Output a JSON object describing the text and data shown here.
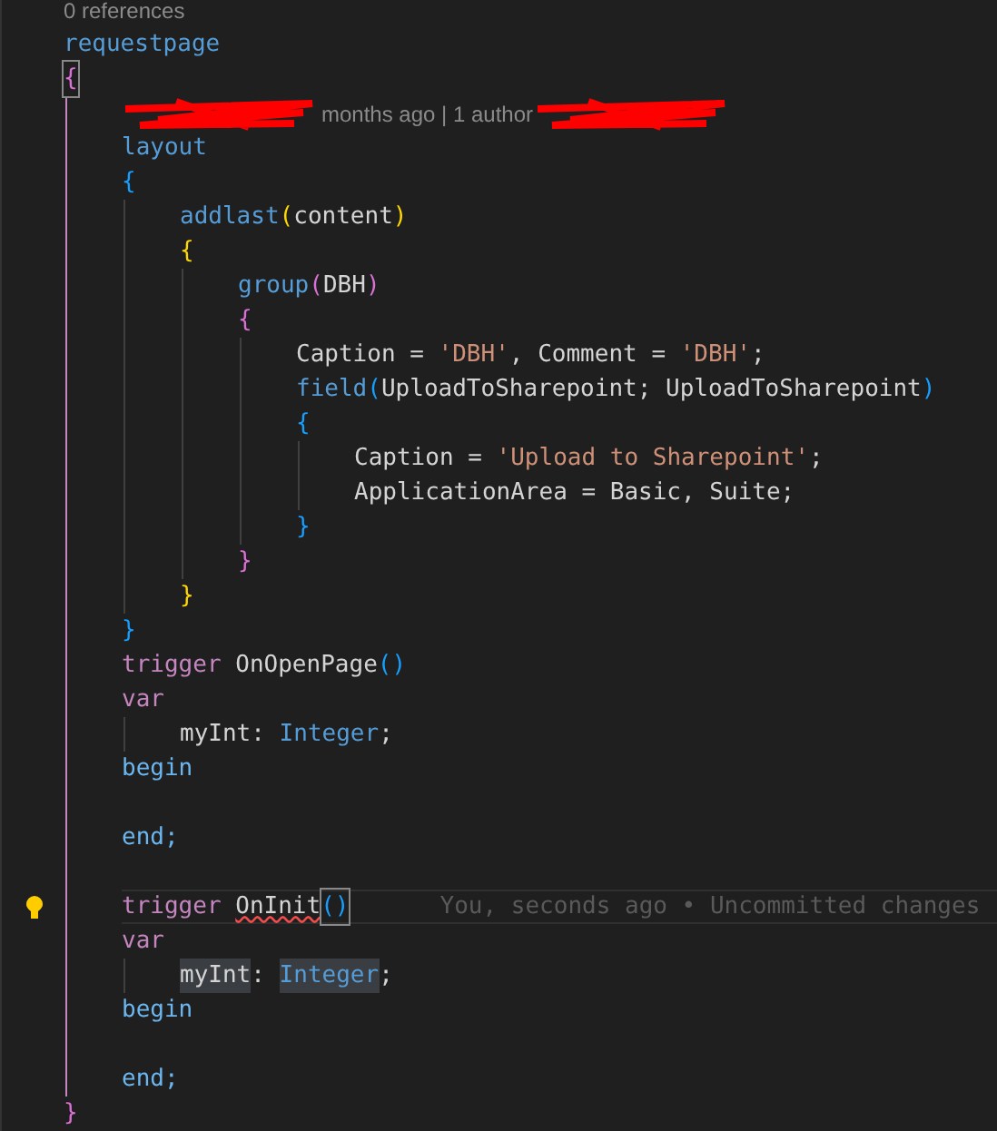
{
  "editor": {
    "lines": [
      {
        "kind": "codelens",
        "tokens": [
          {
            "t": "0 references",
            "kind": "text"
          }
        ]
      },
      {
        "kind": "code",
        "tokens": [
          {
            "t": "requestpage",
            "kind": "kw"
          }
        ]
      },
      {
        "kind": "code",
        "tokens": [
          {
            "t": "{",
            "kind": "b2",
            "matched": true
          }
        ],
        "children": [
          {
            "kind": "codelens",
            "tokens": [
              {
                "kind": "redacted"
              },
              {
                "t": "months ago | 1 author",
                "kind": "text"
              },
              {
                "kind": "redacted"
              }
            ]
          },
          {
            "kind": "code",
            "tokens": [
              {
                "t": "layout",
                "kind": "kw"
              }
            ]
          },
          {
            "kind": "code",
            "tokens": [
              {
                "t": "{",
                "kind": "b3"
              }
            ],
            "children": [
              {
                "kind": "code",
                "tokens": [
                  {
                    "t": "addlast",
                    "kind": "kw"
                  },
                  {
                    "t": "(",
                    "kind": "b1"
                  },
                  {
                    "t": "content",
                    "kind": "plain"
                  },
                  {
                    "t": ")",
                    "kind": "b1"
                  }
                ]
              },
              {
                "kind": "code",
                "tokens": [
                  {
                    "t": "{",
                    "kind": "b1"
                  }
                ],
                "children": [
                  {
                    "kind": "code",
                    "tokens": [
                      {
                        "t": "group",
                        "kind": "kw"
                      },
                      {
                        "t": "(",
                        "kind": "b2"
                      },
                      {
                        "t": "DBH",
                        "kind": "plain"
                      },
                      {
                        "t": ")",
                        "kind": "b2"
                      }
                    ]
                  },
                  {
                    "kind": "code",
                    "tokens": [
                      {
                        "t": "{",
                        "kind": "b2"
                      }
                    ],
                    "children": [
                      {
                        "kind": "code",
                        "tokens": [
                          {
                            "t": "Caption = ",
                            "kind": "plain"
                          },
                          {
                            "t": "'DBH'",
                            "kind": "str"
                          },
                          {
                            "t": ", Comment = ",
                            "kind": "plain"
                          },
                          {
                            "t": "'DBH'",
                            "kind": "str"
                          },
                          {
                            "t": ";",
                            "kind": "plain"
                          }
                        ]
                      },
                      {
                        "kind": "code",
                        "tokens": [
                          {
                            "t": "field",
                            "kind": "kw"
                          },
                          {
                            "t": "(",
                            "kind": "b3"
                          },
                          {
                            "t": "UploadToSharepoint; UploadToSharepoint",
                            "kind": "plain"
                          },
                          {
                            "t": ")",
                            "kind": "b3"
                          }
                        ]
                      },
                      {
                        "kind": "code",
                        "tokens": [
                          {
                            "t": "{",
                            "kind": "b3"
                          }
                        ],
                        "children": [
                          {
                            "kind": "code",
                            "tokens": [
                              {
                                "t": "Caption = ",
                                "kind": "plain"
                              },
                              {
                                "t": "'Upload to Sharepoint'",
                                "kind": "str"
                              },
                              {
                                "t": ";",
                                "kind": "plain"
                              }
                            ]
                          },
                          {
                            "kind": "code",
                            "tokens": [
                              {
                                "t": "ApplicationArea = Basic, Suite;",
                                "kind": "plain"
                              }
                            ]
                          }
                        ]
                      },
                      {
                        "kind": "code",
                        "tokens": [
                          {
                            "t": "}",
                            "kind": "b3"
                          }
                        ]
                      }
                    ]
                  },
                  {
                    "kind": "code",
                    "tokens": [
                      {
                        "t": "}",
                        "kind": "b2"
                      }
                    ]
                  }
                ]
              },
              {
                "kind": "code",
                "tokens": [
                  {
                    "t": "}",
                    "kind": "b1"
                  }
                ]
              }
            ]
          },
          {
            "kind": "code",
            "tokens": [
              {
                "t": "}",
                "kind": "b3"
              }
            ]
          },
          {
            "kind": "code",
            "tokens": [
              {
                "t": "trigger",
                "kind": "ctl"
              },
              {
                "t": " OnOpenPage",
                "kind": "plain"
              },
              {
                "t": "()",
                "kind": "b3"
              }
            ]
          },
          {
            "kind": "code",
            "tokens": [
              {
                "t": "var",
                "kind": "ctl"
              }
            ],
            "children": [
              {
                "kind": "code",
                "tokens": [
                  {
                    "t": "myInt: ",
                    "kind": "plain"
                  },
                  {
                    "t": "Integer",
                    "kind": "type"
                  },
                  {
                    "t": ";",
                    "kind": "plain"
                  }
                ]
              }
            ]
          },
          {
            "kind": "code",
            "tokens": [
              {
                "t": "begin",
                "kind": "kw2"
              }
            ]
          },
          {
            "kind": "blank"
          },
          {
            "kind": "code",
            "tokens": [
              {
                "t": "end;",
                "kind": "kw2"
              }
            ]
          },
          {
            "kind": "blank"
          },
          {
            "kind": "code",
            "current": true,
            "lightbulb": true,
            "blame": "You, seconds ago • Uncommitted changes",
            "tokens": [
              {
                "t": "trigger ",
                "kind": "ctl"
              },
              {
                "t": "OnInit",
                "kind": "plain",
                "error": true
              },
              {
                "t": "()",
                "kind": "b3",
                "matched": true
              }
            ]
          },
          {
            "kind": "code",
            "tokens": [
              {
                "t": "var",
                "kind": "ctl"
              }
            ],
            "children": [
              {
                "kind": "code",
                "tokens": [
                  {
                    "t": "myInt",
                    "kind": "plain",
                    "highlight": true
                  },
                  {
                    "t": ": ",
                    "kind": "plain"
                  },
                  {
                    "t": "Integer",
                    "kind": "type",
                    "highlight": true
                  },
                  {
                    "t": ";",
                    "kind": "plain"
                  }
                ]
              }
            ]
          },
          {
            "kind": "code",
            "tokens": [
              {
                "t": "begin",
                "kind": "kw2"
              }
            ]
          },
          {
            "kind": "blank"
          },
          {
            "kind": "code",
            "tokens": [
              {
                "t": "end;",
                "kind": "kw2"
              }
            ]
          }
        ]
      },
      {
        "kind": "code",
        "tokens": [
          {
            "t": "}",
            "kind": "b2"
          }
        ]
      }
    ]
  }
}
